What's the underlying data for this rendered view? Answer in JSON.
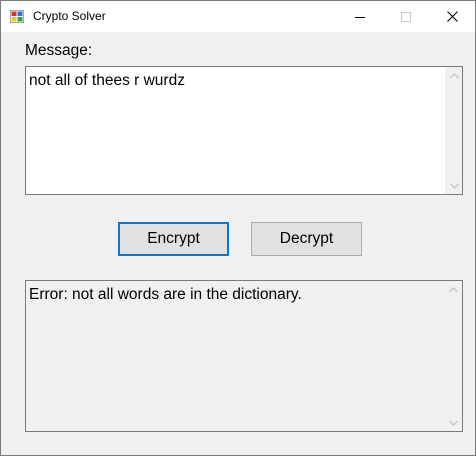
{
  "window": {
    "title": "Crypto Solver",
    "icon": "app-grid-icon"
  },
  "title_buttons": {
    "minimize_icon": "minimize-icon",
    "maximize_icon": "maximize-icon",
    "close_icon": "close-icon"
  },
  "message": {
    "label": "Message:",
    "value": "not all of thees r wurdz"
  },
  "buttons": {
    "encrypt_label": "Encrypt",
    "decrypt_label": "Decrypt"
  },
  "output": {
    "value": "Error: not all words are in the dictionary."
  },
  "colors": {
    "focus_border": "#0078d7",
    "window_bg": "#f0f0f0",
    "button_bg": "#e1e1e1"
  }
}
